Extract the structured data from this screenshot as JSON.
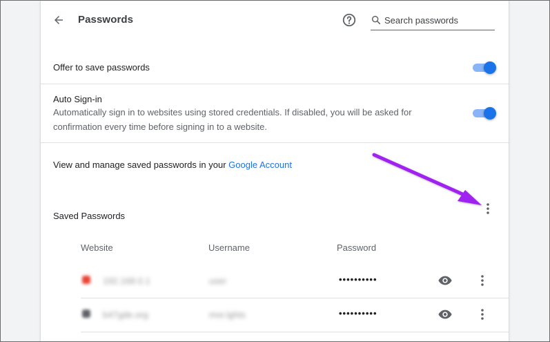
{
  "header": {
    "title": "Passwords",
    "search_placeholder": "Search passwords"
  },
  "settings": {
    "offer_save": {
      "label": "Offer to save passwords",
      "enabled": true
    },
    "auto_signin": {
      "label": "Auto Sign-in",
      "description": "Automatically sign in to websites using stored credentials. If disabled, you will be asked for confirmation every time before signing in to a website.",
      "enabled": true
    }
  },
  "account": {
    "text": "View and manage saved passwords in your ",
    "link": "Google Account"
  },
  "saved": {
    "title": "Saved Passwords",
    "columns": [
      "Website",
      "Username",
      "Password"
    ],
    "rows": [
      {
        "website": "192.168.0.1",
        "username": "user",
        "password": "••••••••••",
        "favicon_color": "#ea4335"
      },
      {
        "website": "b47gde.org",
        "username": "mor.lghts",
        "password": "••••••••••",
        "favicon_color": "#5f6368"
      }
    ]
  },
  "colors": {
    "accent": "#1a73e8",
    "toggle_track": "#8ab4f8",
    "annotation": "#a020f0"
  },
  "icons": [
    "back-arrow-icon",
    "help-icon",
    "search-icon",
    "more-vert-icon",
    "eye-icon"
  ]
}
